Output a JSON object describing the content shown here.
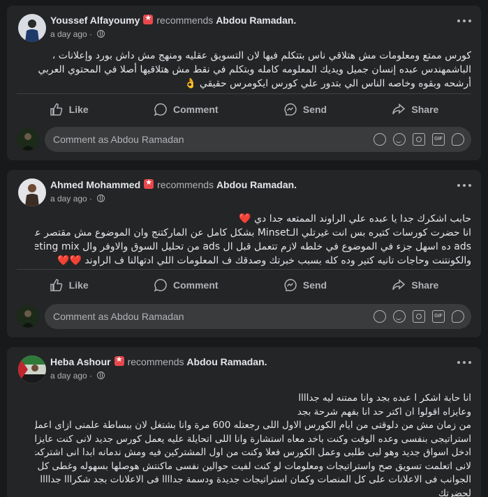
{
  "posts": [
    {
      "author": "Youssef Alfayoumy",
      "verb": "recommends",
      "target": "Abdou Ramadan.",
      "time": "a day ago · ",
      "lines": [
        "كورس ممتع ومعلومات مش هتلاقي ناس بتتكلم فيها لان التسويق عقليه ومنهج مش داش بورد وإعلانات ،",
        "الباشمهندس عبده إنسان جميل ويديك المعلومه كامله وبتكلم في نقط مش هتلاقيها أصلا في المحتوي العربي",
        "أرشحه وبقوه وخاصه الناس الي بتدور علي كورس ايكومرس حقيقي 👌"
      ]
    },
    {
      "author": "Ahmed Mohammed",
      "verb": "recommends",
      "target": "Abdou Ramadan.",
      "time": "a day ago · ",
      "lines": [
        "حابب اشكرك جدا يا عبده علي الراوند الممتعه جدا دي ❤️",
        "انا حضرت كورسات كتيره بس انت غيرتلي الـMinset بشكل كامل عن الماركتنج وان الموضوع مش مقتصر علي ال",
        "ads ده اسهل جزء في الموضوع في خلطه لازم تتعمل قبل ال ads من تحليل السوق والاوفر وال marketing mix",
        "والكونتنت وحاجات تانيه كتير وده كله بسبب خبرتك وصدقك ف المعلومات اللي ادتهالنا ف الراوند ❤️❤️"
      ]
    },
    {
      "author": "Heba Ashour",
      "verb": "recommends",
      "target": "Abdou Ramadan.",
      "time": "a day ago · ",
      "lines": [
        "انا حابة اشكر ا عبده بجد وانا ممتنه ليه جداااا",
        "وعايزاه اقولوا ان اكتر حد انا بفهم شرحة بجد",
        "من زمان مش من دلوقتى من ايام الكورس الاول اللى رجعتله 600 مرة وانا بشتغل لان ببساطة علمنى ازاى اعمل",
        "استراتيجى بنفسى وعده الوقت وكنت باخد معاه استشارة  وانا اللى اتحايلة عليه يعمل كورس جديد لانى كنت عايزاه",
        "ادخل اسواق جديد وهو لبى طلبى وعمل الكورس فعلا وكنت من اول المشتركين فيه ومش ندمانه ابدا انى اشتركت",
        "لانى اتعلمت تسويق صح واستراتيجات ومعلومات لو كنت لفيت حوالين نفسى ماكنتش هوصلها بسهوله وغطى كل",
        "الجوانب فى الاعلانات على كل المنصات وكمان استراتيجات جديدة ودسمة جداااا فى الاعلانات بجد شكرااا جداااا",
        "لحضرتك"
      ]
    }
  ],
  "actions": {
    "like": "Like",
    "comment": "Comment",
    "send": "Send",
    "share": "Share"
  },
  "comment_placeholder": "Comment as Abdou Ramadan",
  "colors": {
    "background": "#18191a",
    "card": "#242526",
    "badge": "#e8484d",
    "muted": "#b0b3b8"
  }
}
